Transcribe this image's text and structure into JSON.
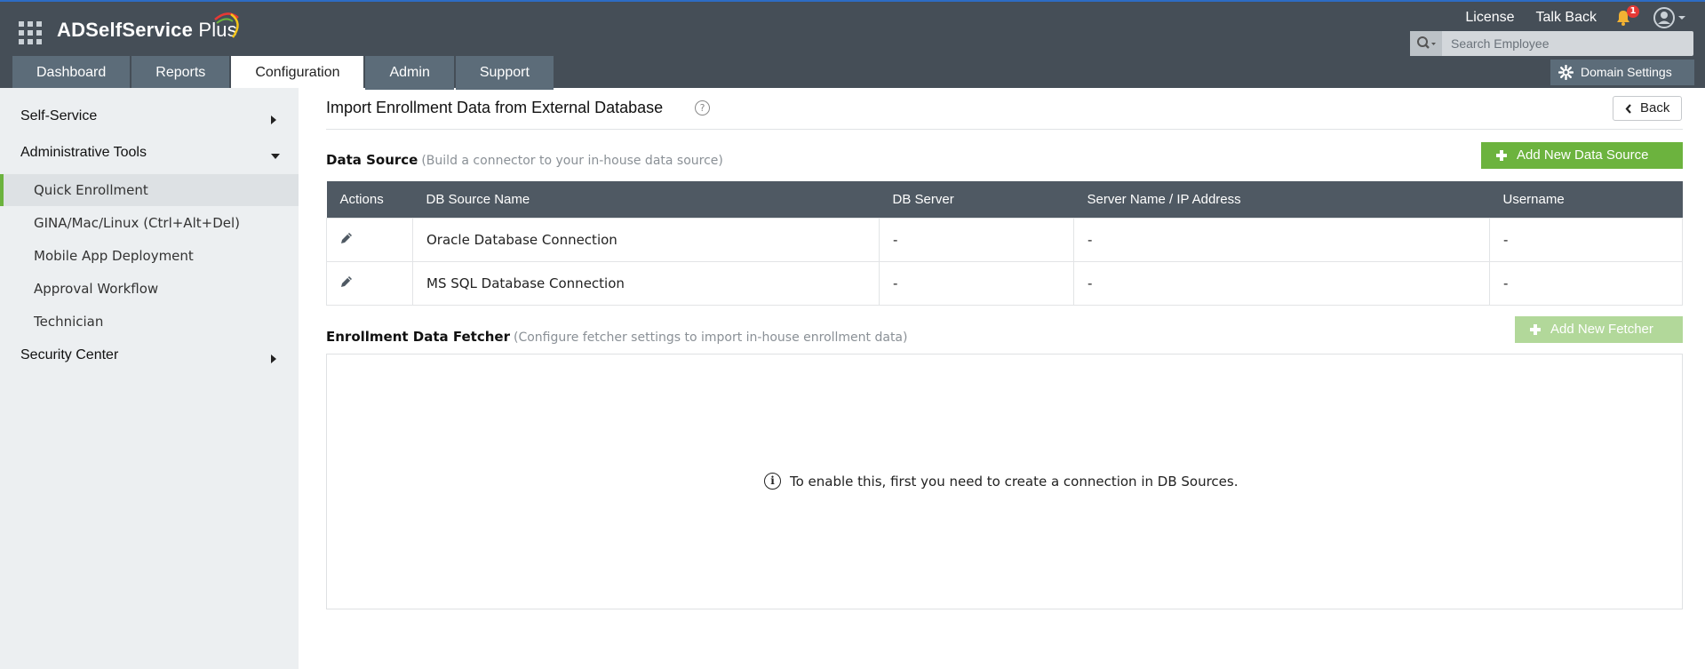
{
  "app": {
    "name_bold": "ADSelfService",
    "name_plus": " Plus"
  },
  "top_links": {
    "license": "License",
    "talk_back": "Talk Back",
    "notification_count": "1"
  },
  "search": {
    "placeholder": "Search Employee"
  },
  "tabs": [
    {
      "label": "Dashboard"
    },
    {
      "label": "Reports"
    },
    {
      "label": "Configuration",
      "active": true
    },
    {
      "label": "Admin"
    },
    {
      "label": "Support"
    }
  ],
  "domain_settings": "Domain Settings",
  "sidebar": {
    "self_service": "Self-Service",
    "admin_tools": "Administrative Tools",
    "items": [
      {
        "label": "Quick Enrollment",
        "active": true
      },
      {
        "label": "GINA/Mac/Linux (Ctrl+Alt+Del)"
      },
      {
        "label": "Mobile App Deployment"
      },
      {
        "label": "Approval Workflow"
      },
      {
        "label": "Technician"
      }
    ],
    "security_center": "Security Center"
  },
  "main": {
    "title": "Import Enrollment Data from External Database",
    "help": "?",
    "back": "Back",
    "data_source": {
      "label": "Data Source",
      "sub": "(Build a connector to your in-house data source)",
      "add_button": "Add New Data Source",
      "columns": [
        "Actions",
        "DB Source Name",
        "DB Server",
        "Server Name / IP Address",
        "Username"
      ],
      "rows": [
        {
          "name": "Oracle Database Connection",
          "server": "-",
          "ip": "-",
          "user": "-"
        },
        {
          "name": "MS SQL Database Connection",
          "server": "-",
          "ip": "-",
          "user": "-"
        }
      ]
    },
    "fetcher": {
      "label": "Enrollment Data Fetcher",
      "sub": "(Configure fetcher settings to import in-house enrollment data)",
      "add_button": "Add New Fetcher",
      "message": "To enable this, first you need to create a connection in DB Sources."
    }
  },
  "colors": {
    "header": "#454e57",
    "accent_green": "#6cb33e",
    "tab": "#5c6c79"
  }
}
